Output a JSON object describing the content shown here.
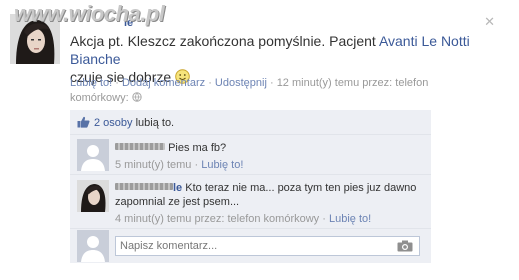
{
  "watermark": "www.wiocha.pl",
  "post": {
    "author_suffix": "le",
    "text_before": "Akcja pt. Kleszcz zakończona pomyślnie. Pacjent ",
    "text_link": "Avanti Le Notti Bianche",
    "text_after": " czuje sie dobrze "
  },
  "meta": {
    "like": "Lubię to!",
    "comment": "Dodaj komentarz",
    "share": "Udostępnij",
    "time": "12 minut(y) temu przez: telefon",
    "device": "komórkowy"
  },
  "likes": {
    "count": "2 osoby",
    "suffix": " lubią to."
  },
  "comments": [
    {
      "author_suffix": "",
      "text": "Pies ma fb?",
      "time": "5 minut(y) temu",
      "like": "Lubię to!"
    },
    {
      "author_suffix": "le",
      "text": "Kto teraz nie ma... poza tym ten pies juz dawno zapomnial ze jest psem...",
      "time": "4 minut(y) temu przez: telefon komórkowy",
      "like": "Lubię to!"
    }
  ],
  "composer": {
    "placeholder": "Napisz komentarz..."
  },
  "colors": {
    "link": "#3b5998",
    "ufi_bg": "#edeff4",
    "meta_text": "#999999"
  }
}
